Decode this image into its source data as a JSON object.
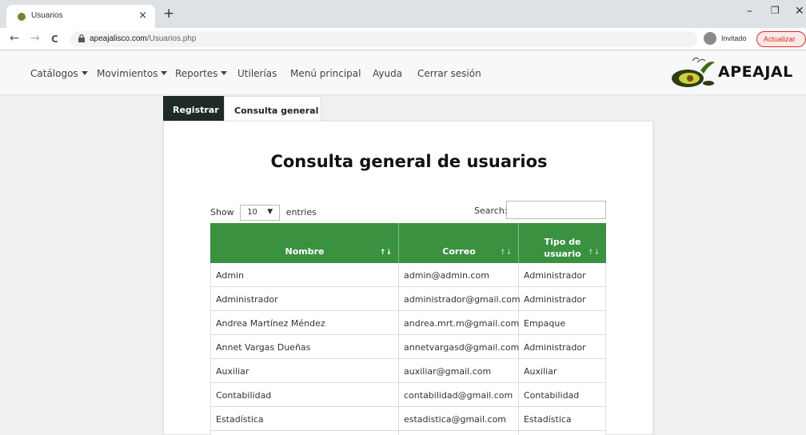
{
  "browser": {
    "tab_title": "Usuarios",
    "tab_close": "×",
    "new_tab": "+",
    "url_domain": "apeajalisco.com",
    "url_path": "/Usuarios.php",
    "profile_label": "Invitado",
    "update_label": "Actualizar",
    "win_min": "–",
    "win_restore": "❐",
    "win_close": "✕",
    "back": "←",
    "forward": "→",
    "reload": "C"
  },
  "nav": {
    "items": [
      {
        "label": "Catálogos",
        "dropdown": true
      },
      {
        "label": "Movimientos",
        "dropdown": true
      },
      {
        "label": "Reportes",
        "dropdown": true
      },
      {
        "label": "Utilerías",
        "dropdown": false
      },
      {
        "label": "Menú principal",
        "dropdown": false
      },
      {
        "label": "Ayuda",
        "dropdown": false
      },
      {
        "label": "Cerrar sesión",
        "dropdown": false
      }
    ],
    "brand": "APEAJAL"
  },
  "tabs": {
    "register": "Registrar",
    "consult": "Consulta general"
  },
  "main": {
    "title": "Consulta general de usuarios",
    "show_label": "Show",
    "entries_value": "10",
    "entries_label": "entries",
    "search_label": "Search:"
  },
  "table": {
    "headers": [
      "Nombre",
      "Correo",
      "Tipo de usuario"
    ],
    "header3_line1": "Tipo de",
    "header3_line2": "usuario",
    "rows": [
      [
        "Admin",
        "admin@admin.com",
        "Administrador"
      ],
      [
        "Administrador",
        "administrador@gmail.com",
        "Administrador"
      ],
      [
        "Andrea Martínez Méndez",
        "andrea.mrt.m@gmail.com",
        "Empaque"
      ],
      [
        "Annet Vargas Dueñas",
        "annetvargasd@gmail.com",
        "Administrador"
      ],
      [
        "Auxiliar",
        "auxiliar@gmail.com",
        "Auxiliar"
      ],
      [
        "Contabilidad",
        "contabilidad@gmail.com",
        "Contabilidad"
      ],
      [
        "Estadística",
        "estadistica@gmail.com",
        "Estadística"
      ],
      [
        "",
        "",
        ""
      ]
    ]
  },
  "colors": {
    "header_green": "#3a9140",
    "register_tab": "#1f2a25"
  }
}
